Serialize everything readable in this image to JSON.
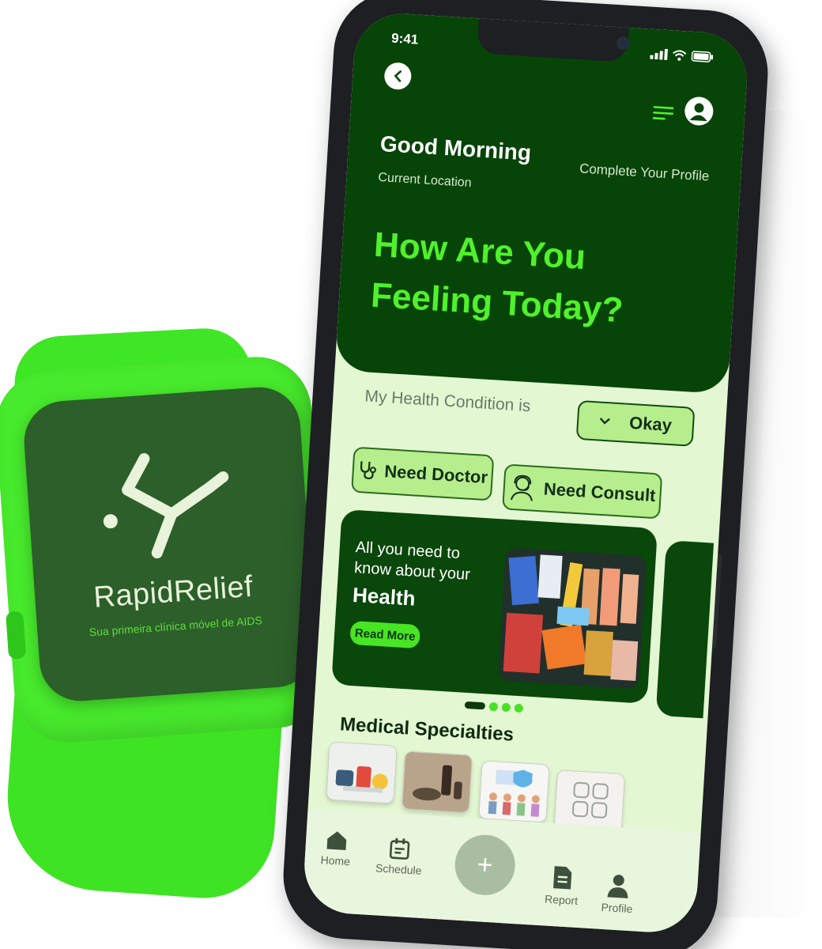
{
  "watch": {
    "brand": "RapidRelief",
    "tagline": "Sua primeira clínica móvel de AIDS"
  },
  "status_bar": {
    "time": "9:41"
  },
  "header": {
    "greeting": "Good Morning",
    "location": "Current Location",
    "profile_link": "Complete Your Profile"
  },
  "hero": {
    "headline_line1": "How Are You",
    "headline_line2": "Feeling Today?"
  },
  "condition": {
    "label": "My Health Condition is",
    "selected": "Okay"
  },
  "actions": {
    "need_doctor": "Need Doctor",
    "need_consult": "Need Consult"
  },
  "banner": {
    "text": "All you need to know about your",
    "strong": "Health",
    "button": "Read More"
  },
  "specialties": {
    "title": "Medical Specialties"
  },
  "nav": {
    "home": "Home",
    "schedule": "Schedule",
    "report": "Report",
    "profile": "Profile",
    "fab": "+"
  },
  "colors": {
    "dark_green": "#074407",
    "accent_green": "#4ff22a",
    "watch_green": "#47ea2c",
    "light_bg": "#e3f7d2",
    "chip_green": "#b7ee8d"
  },
  "carousel": {
    "active_index": 0,
    "count": 4
  }
}
